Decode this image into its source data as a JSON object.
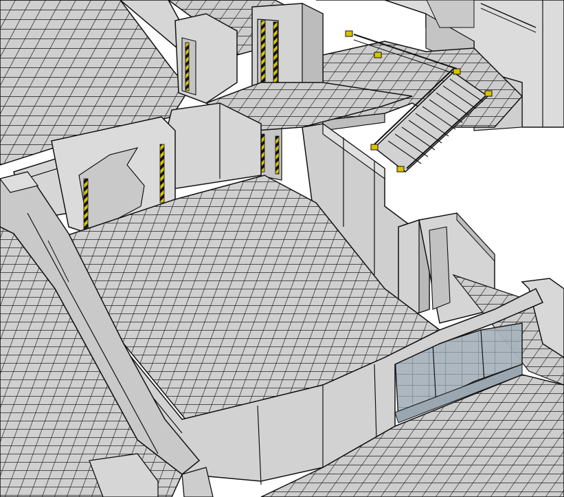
{
  "scene": {
    "subject": "isometric-3d-model-sci-fi-interior",
    "style": "sketch-line-render",
    "colors": {
      "background": "#ffffff",
      "floor_fill": "#cfcfcf",
      "tile_line": "#1a1a1a",
      "wall_light": "#d9d9d9",
      "wall_shadow": "#b8b8b8",
      "wall_dark": "#a9a9a9",
      "hazard_yellow": "#d8c300",
      "hazard_black": "#141414",
      "glass": "#a9b4bd",
      "outline": "#111111"
    },
    "features": [
      "upper-left-tiled-floor",
      "upper-corridor-with-hazard-doors",
      "raised-landing",
      "staircase",
      "central-tiled-room",
      "broken-doorway",
      "glass-partition-room",
      "lower-left-tiled-floor"
    ]
  }
}
